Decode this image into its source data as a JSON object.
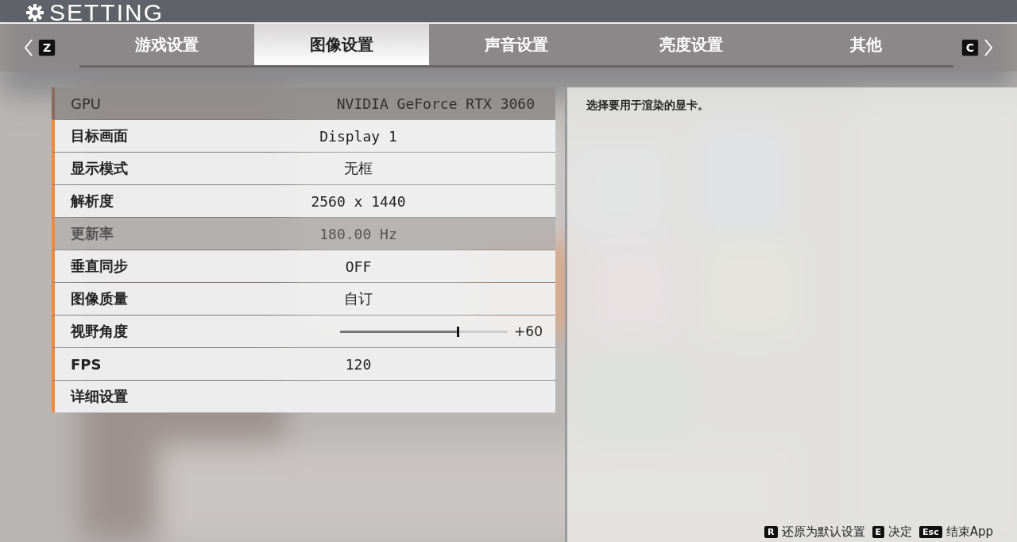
{
  "header": {
    "title": "SETTING"
  },
  "tab_nav": {
    "prev_key": "Z",
    "next_key": "C"
  },
  "tabs": [
    {
      "label": "游戏设置",
      "selected": false
    },
    {
      "label": "图像设置",
      "selected": true
    },
    {
      "label": "声音设置",
      "selected": false
    },
    {
      "label": "亮度设置",
      "selected": false
    },
    {
      "label": "其他",
      "selected": false
    }
  ],
  "settings": [
    {
      "kind": "value",
      "label": "GPU",
      "value": "NVIDIA GeForce RTX 3060",
      "selected": true,
      "disabled": false
    },
    {
      "kind": "value",
      "label": "目标画面",
      "value": "Display 1",
      "selected": false,
      "disabled": false
    },
    {
      "kind": "value",
      "label": "显示模式",
      "value": "无框",
      "selected": false,
      "disabled": false
    },
    {
      "kind": "value",
      "label": "解析度",
      "value": "2560 x 1440",
      "selected": false,
      "disabled": false
    },
    {
      "kind": "value",
      "label": "更新率",
      "value": "180.00 Hz",
      "selected": false,
      "disabled": true
    },
    {
      "kind": "value",
      "label": "垂直同步",
      "value": "OFF",
      "selected": false,
      "disabled": false
    },
    {
      "kind": "value",
      "label": "图像质量",
      "value": "自订",
      "selected": false,
      "disabled": false
    },
    {
      "kind": "slider",
      "label": "视野角度",
      "level": 0.7,
      "reading": "+60",
      "selected": false,
      "disabled": false
    },
    {
      "kind": "value",
      "label": "FPS",
      "value": "120",
      "selected": false,
      "disabled": false
    },
    {
      "kind": "link",
      "label": "详细设置",
      "selected": false,
      "disabled": false
    }
  ],
  "description": "选择要用于渲染的显卡。",
  "footer_hints": [
    {
      "key": "R",
      "label": "还原为默认设置"
    },
    {
      "key": "E",
      "label": "决定"
    },
    {
      "key": "Esc",
      "label": "结束App"
    }
  ]
}
